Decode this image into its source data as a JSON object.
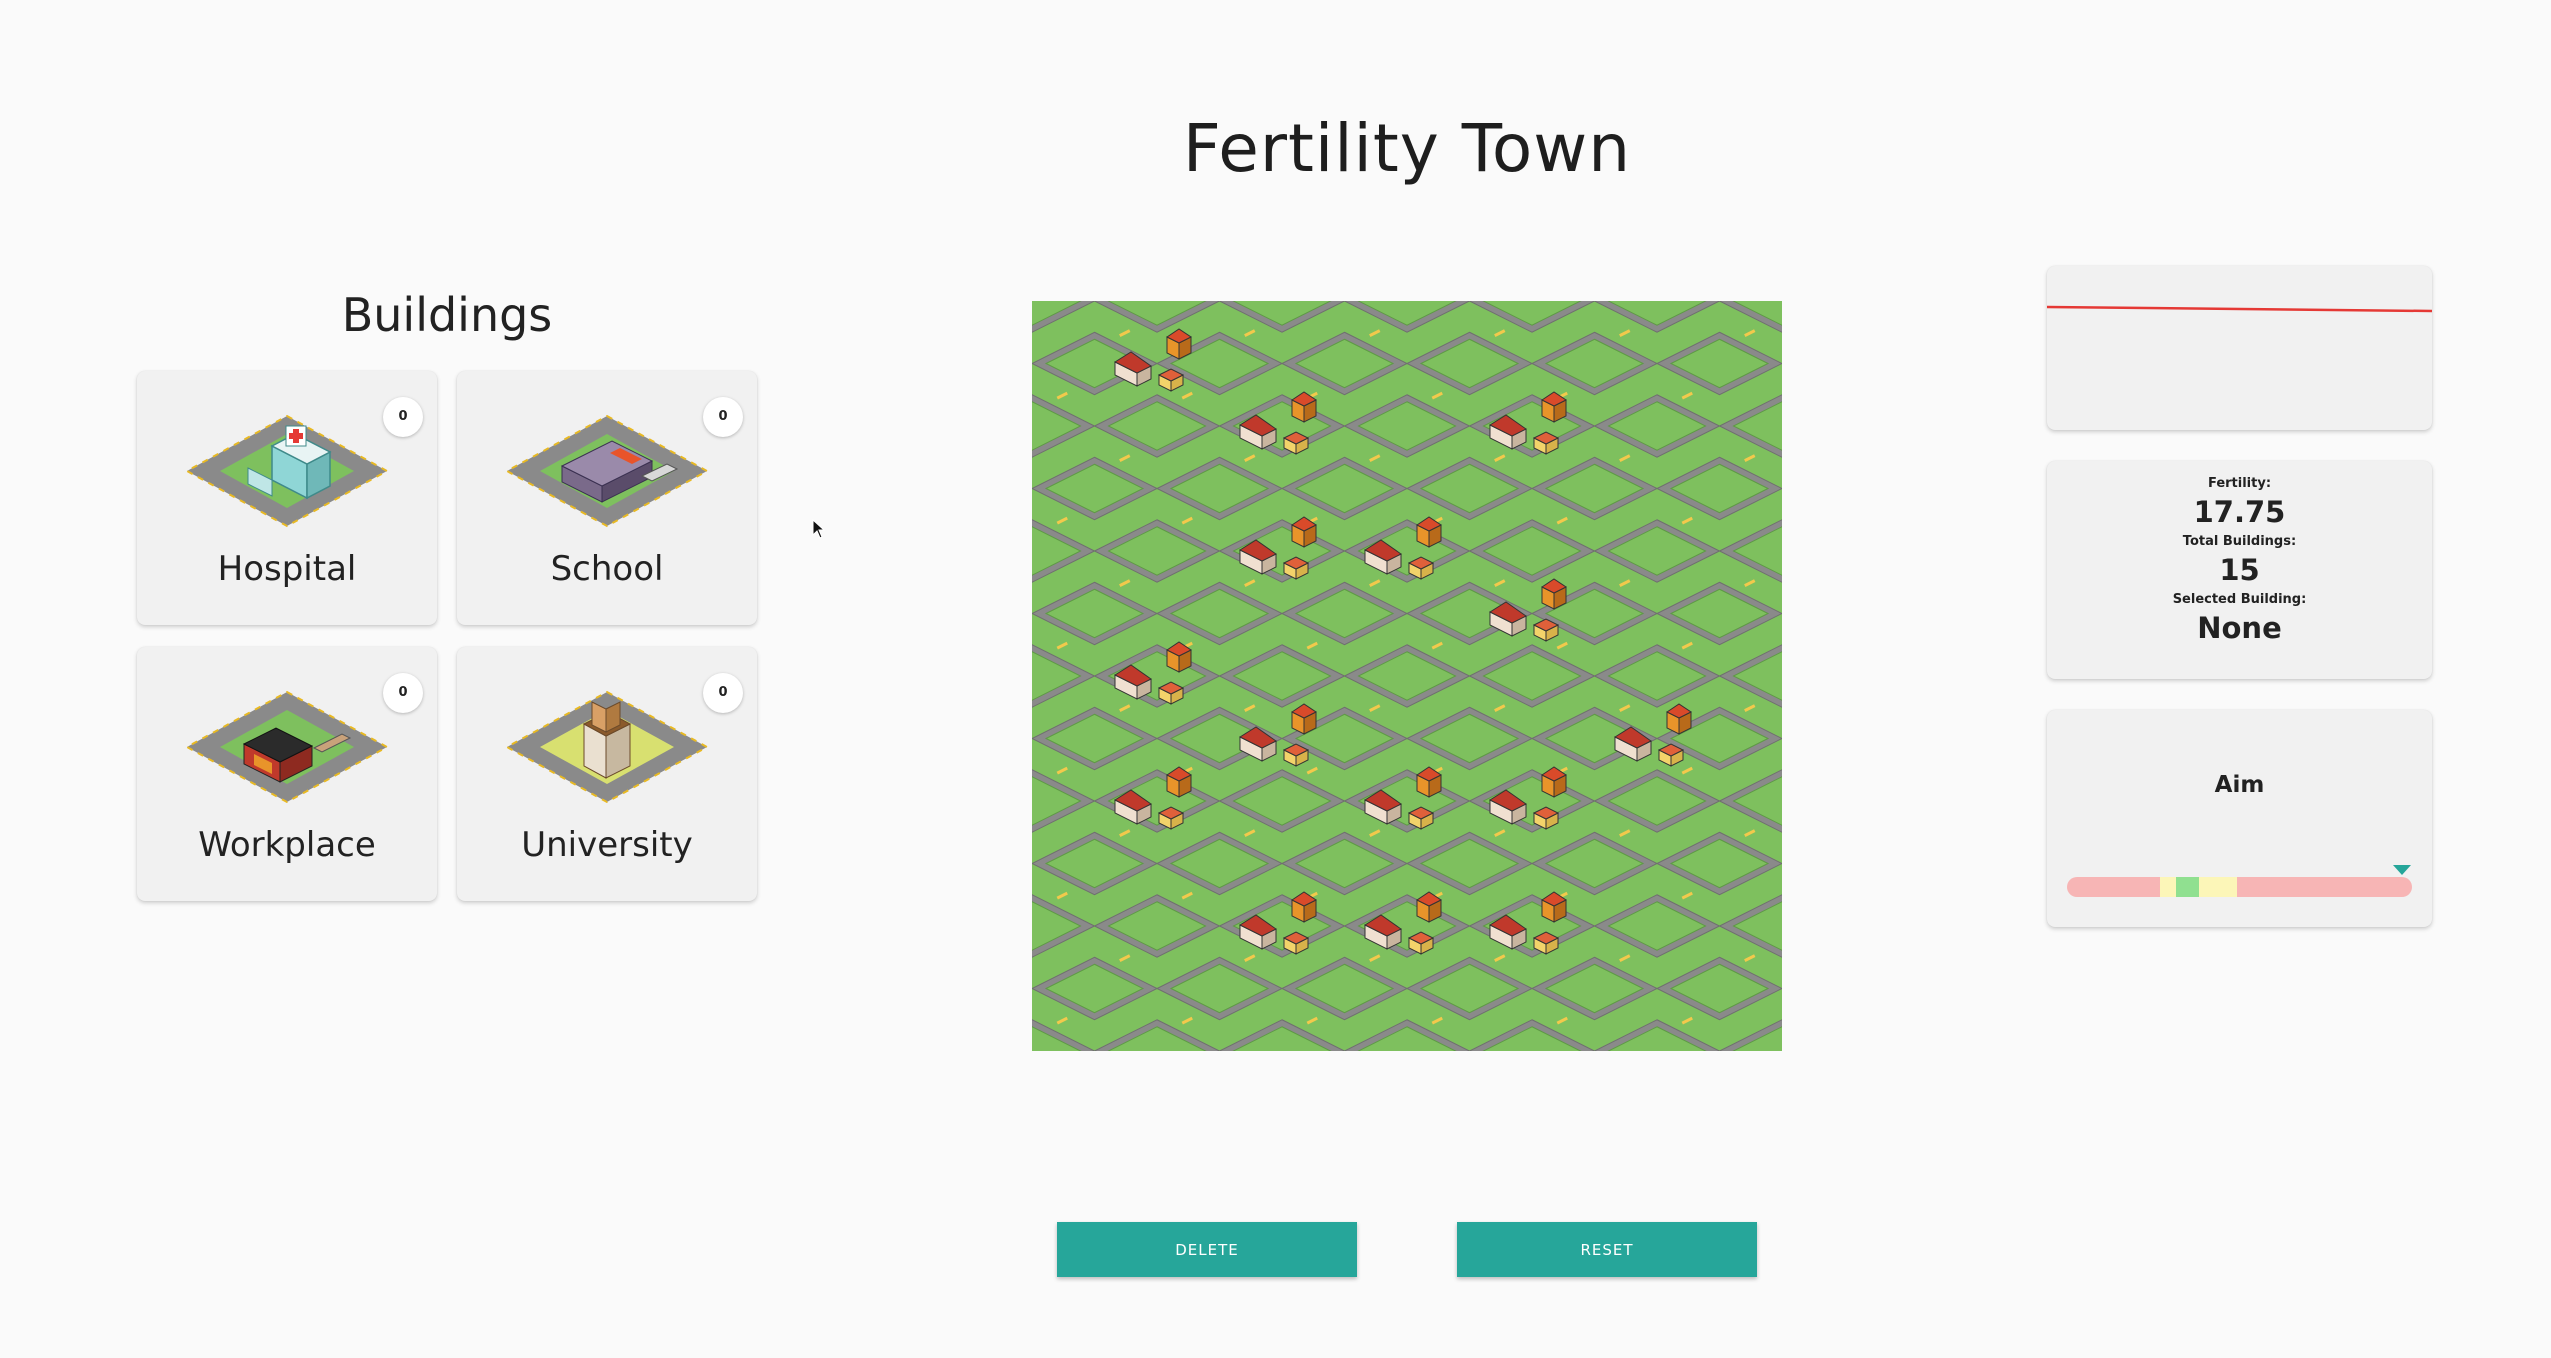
{
  "title": "Fertility Town",
  "buildings": {
    "heading": "Buildings",
    "items": [
      {
        "label": "Hospital",
        "count": "0",
        "icon": "hospital-icon"
      },
      {
        "label": "School",
        "count": "0",
        "icon": "school-icon"
      },
      {
        "label": "Workplace",
        "count": "0",
        "icon": "workplace-icon"
      },
      {
        "label": "University",
        "count": "0",
        "icon": "university-icon"
      }
    ]
  },
  "stats": {
    "fertility_label": "Fertility:",
    "fertility_value": "17.75",
    "total_label": "Total Buildings:",
    "total_value": "15",
    "selected_label": "Selected Building:",
    "selected_value": "None"
  },
  "aim": {
    "label": "Aim",
    "marker_position": 0.97
  },
  "buttons": {
    "delete": "DELETE",
    "reset": "RESET"
  },
  "colors": {
    "accent": "#26a69a",
    "grass": "#7ec05e",
    "road": "#8a8a8a",
    "roof": "#c0392b",
    "house": "#e8942a",
    "trend_line": "#e53935"
  }
}
